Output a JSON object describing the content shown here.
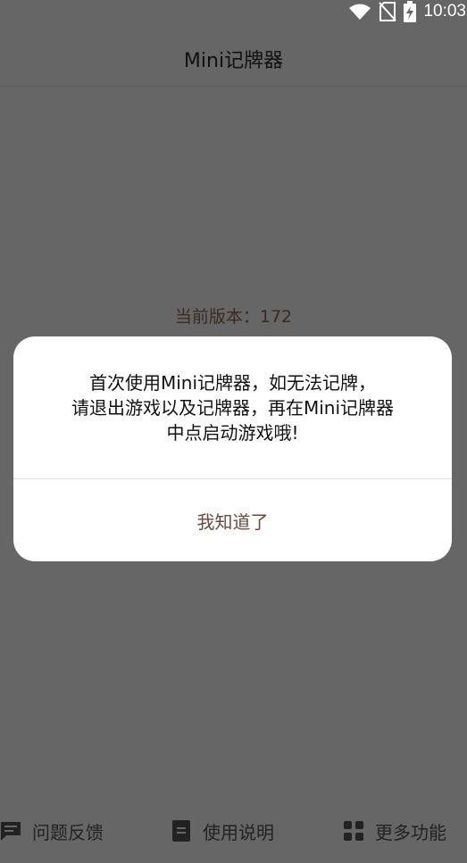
{
  "status_bar": {
    "time": "10:03"
  },
  "app": {
    "title": "Mini记牌器"
  },
  "main": {
    "version_text": "当前版本：172"
  },
  "dialog": {
    "message_line1": "首次使用Mini记牌器，如无法记牌，",
    "message_line2": "请退出游戏以及记牌器，再在Mini记牌器",
    "message_line3": "中点启动游戏哦!",
    "ok_label": "我知道了"
  },
  "bottom_nav": {
    "items": [
      {
        "label": "问题反馈",
        "icon": "feedback-icon"
      },
      {
        "label": "使用说明",
        "icon": "document-icon"
      },
      {
        "label": "更多功能",
        "icon": "grid-icon"
      }
    ]
  },
  "colors": {
    "overlay_bg": "#666666",
    "dialog_bg": "#ffffff",
    "accent_text": "#6b4a40"
  }
}
